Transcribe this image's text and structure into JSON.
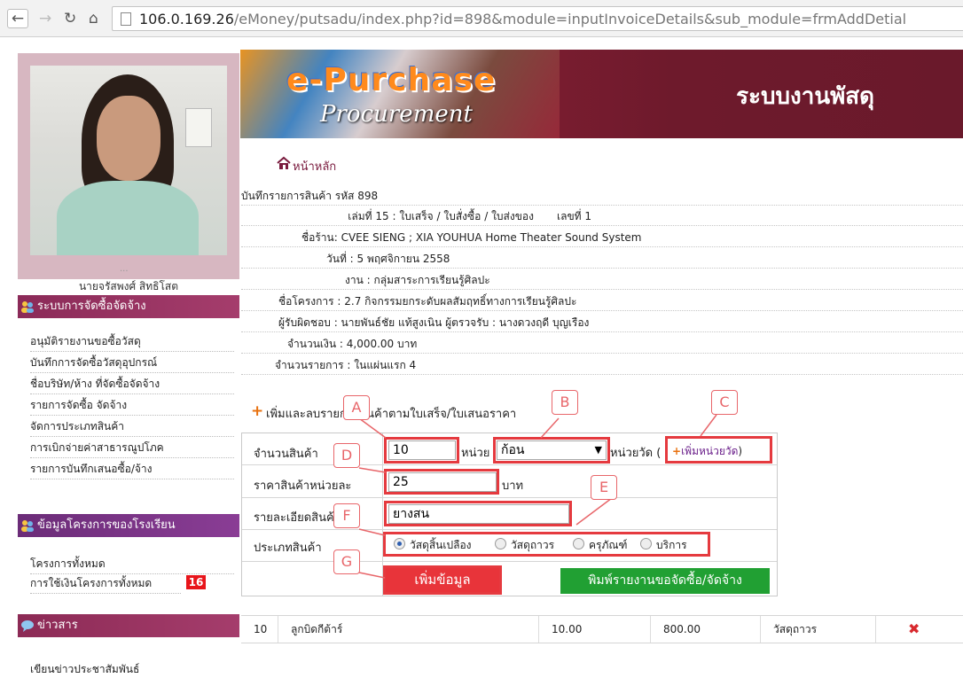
{
  "browser": {
    "url_host": "106.0.169.26",
    "url_rest": "/eMoney/putsadu/index.php?id=898&module=inputInvoiceDetails&sub_module=frmAddDetial"
  },
  "profile": {
    "dots": "...",
    "name": "นายจรัสพงศ์ สิทธิโสต"
  },
  "sidebar": {
    "procurement_header": "ระบบการจัดซื้อจัดจ้าง",
    "procurement_items": [
      "อนุมัติรายงานขอซื้อวัสดุ",
      "บันทึกการจัดซื้อวัสดุอุปกรณ์",
      "ชื่อบริษัท/ห้าง ที่จัดซื้อจัดจ้าง",
      "รายการจัดซื้อ จัดจ้าง",
      "จัดการประเภทสินค้า",
      "การเบิกจ่ายค่าสาธารณูปโภค",
      "รายการบันทึกเสนอซื้อ/จ้าง"
    ],
    "school_header": "ข้อมูลโครงการของโรงเรียน",
    "school_items": [
      "โครงการทั้งหมด",
      "การใช้เงินโครงการทั้งหมด"
    ],
    "badge": "16",
    "news_header": "ข่าวสาร",
    "news_items": [
      "เขียนข่าวประชาสัมพันธ์"
    ]
  },
  "banner": {
    "logo_line1": "e-Purchase",
    "logo_line2": "Procurement",
    "title": "ระบบงานพัสดุ"
  },
  "home_link": "หน้าหลัก",
  "info": {
    "record_title": "บันทึกรายการสินค้า รหัส 898",
    "book_label": "เล่มที่ 15 : ใบเสร็จ / ใบสั่งซื้อ / ใบส่งของ",
    "number_label": "เลขที่ 1",
    "shop": "ชื่อร้าน: CVEE SIENG ; XIA YOUHUA Home Theater Sound System",
    "date": "วันที่ : 5 พฤศจิกายน 2558",
    "work": "งาน : กลุ่มสาระการเรียนรู้ศิลปะ",
    "project": "ชื่อโครงการ : 2.7 กิจกรรมยกระดับผลสัมฤทธิ์ทางการเรียนรู้ศิลปะ",
    "responsible": "ผู้รับผิดชอบ : นายพันธ์ชัย แท้สูงเนิน    ผู้ตรวจรับ : นางดวงฤดี บุญเรือง",
    "amount": "จำนวนเงิน : 4,000.00 บาท",
    "items_count": "จำนวนรายการ : ในแผ่นแรก 4"
  },
  "section_title": "เพิ่มและลบรายการสินค้าตามใบเสร็จ/ใบเสนอราคา",
  "form": {
    "qty_label": "จำนวนสินค้า",
    "qty_value": "10",
    "unit_label": "หน่วย",
    "unit_value": "ก้อน",
    "unit_suffix": "หน่วยวัด (",
    "add_unit": "เพิ่มหน่วยวัด",
    "add_unit_close": ")",
    "price_label": "ราคาสินค้าหน่วยละ",
    "price_value": "25",
    "price_suffix": "บาท",
    "detail_label": "รายละเอียดสินค้า",
    "detail_value": "ยางสน",
    "type_label": "ประเภทสินค้า",
    "types": [
      "วัสดุสิ้นเปลือง",
      "วัสดุถาวร",
      "ครุภัณฑ์",
      "บริการ"
    ],
    "add_button": "เพิ่มข้อมูล",
    "print_button": "พิมพ์รายงานขอจัดซื้อ/จัดจ้าง"
  },
  "callouts": [
    "A",
    "B",
    "C",
    "D",
    "E",
    "F",
    "G"
  ],
  "item_row": {
    "qty": "10",
    "name": "ลูกบิดกีต้าร์",
    "price": "10.00",
    "total": "800.00",
    "type": "วัสดุถาวร",
    "delete": "✖"
  },
  "colors": {
    "accent": "#8b2a58",
    "highlight": "#e53a3f",
    "print_button": "#21a033"
  }
}
